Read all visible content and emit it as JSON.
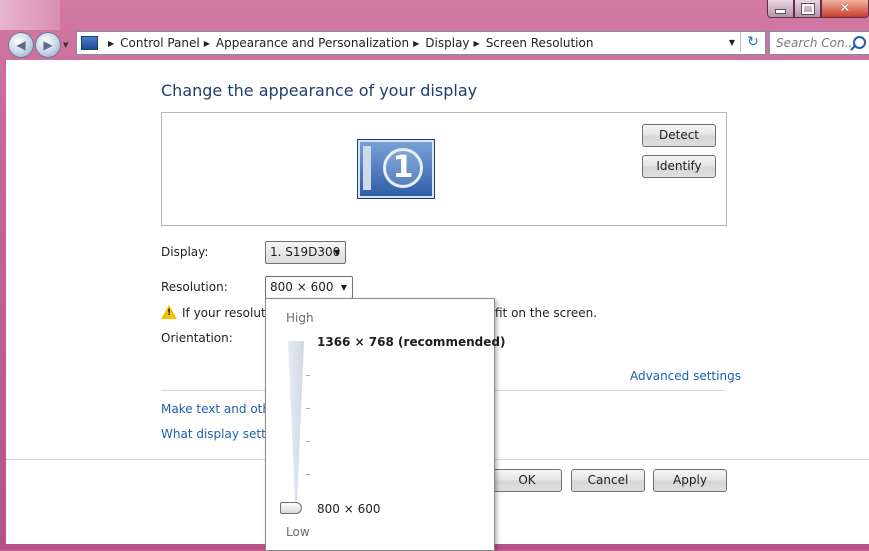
{
  "window": {
    "min_icon": "minimize-icon",
    "max_icon": "maximize-icon",
    "close_icon": "close-icon"
  },
  "address_bar": {
    "crumbs": [
      "Control Panel",
      "Appearance and Personalization",
      "Display",
      "Screen Resolution"
    ],
    "search_placeholder": "Search Con..."
  },
  "page": {
    "title": "Change the appearance of your display",
    "detect_label": "Detect",
    "identify_label": "Identify",
    "monitor_number": "1"
  },
  "settings": {
    "display_label": "Display:",
    "display_value": "1. S19D300",
    "resolution_label": "Resolution:",
    "resolution_value": "800 × 600",
    "orientation_label": "Orientation:",
    "warning_text": "If your resolutio",
    "warning_text_end": "fit on the screen."
  },
  "links": {
    "advanced": "Advanced settings",
    "make_text": "Make text and other",
    "what_display": "What display setting"
  },
  "buttons": {
    "ok": "OK",
    "cancel": "Cancel",
    "apply": "Apply"
  },
  "resolution_popup": {
    "high_label": "High",
    "low_label": "Low",
    "top_option": "1366 × 768 (recommended)",
    "bottom_option": "800 × 600",
    "slider_level": 0
  }
}
